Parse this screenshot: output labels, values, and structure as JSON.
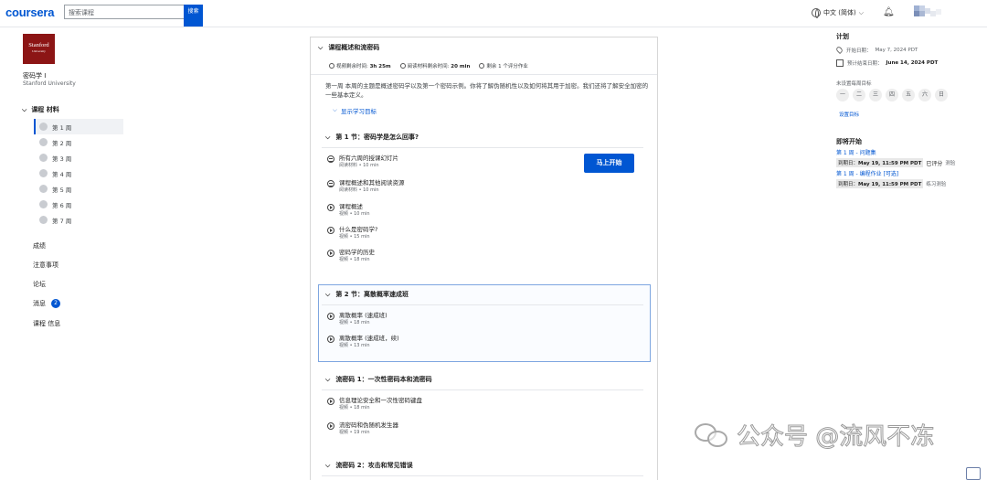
{
  "header": {
    "logo": "coursera",
    "search_placeholder": "搜索课程",
    "search_button": "搜索",
    "language": "中文 (简体)",
    "icons": [
      "globe-icon",
      "chevron-down-icon",
      "bell-icon",
      "avatar"
    ]
  },
  "sidebar": {
    "school_logo_text": "Stanford",
    "school_logo_sub": "University",
    "course_title": "密码学 I",
    "school": "Stanford University",
    "materials_label": "课程 材料",
    "weeks": [
      "第 1 周",
      "第 2 周",
      "第 3 周",
      "第 4 周",
      "第 5 周",
      "第 6 周",
      "第 7 周"
    ],
    "active_week_index": 0,
    "nav": [
      {
        "label": "成绩"
      },
      {
        "label": "注意事项"
      },
      {
        "label": "论坛"
      },
      {
        "label": "消息",
        "badge": "2"
      },
      {
        "label": "课程 信息"
      }
    ]
  },
  "main": {
    "module_title": "课程概述和流密码",
    "stats": [
      {
        "label": "视频剩余时间:",
        "value": "3h 25m"
      },
      {
        "label": "阅读材料剩余时间:",
        "value": "20 min"
      },
      {
        "label": "剩余 1 个评分作业",
        "value": ""
      }
    ],
    "description": "第一周 本周的主题是概述密码学以及第一个密码示例。你将了解伪随机性以及如何将其用于加密。我们还将了解安全加密的一些基本定义。",
    "goals_link": "显示学习目标",
    "start_button": "马上开始",
    "sections": [
      {
        "title": "第 1 节：密码学是怎么回事?",
        "items": [
          {
            "title": "所有六周的授课幻灯片",
            "meta": "阅读材料 • 10 min",
            "icon": "reading-icon"
          },
          {
            "title": "课程概述和其他阅读资源",
            "meta": "阅读材料 • 10 min",
            "icon": "reading-icon"
          },
          {
            "title": "课程概述",
            "meta": "视频 • 10 min",
            "icon": "play-icon"
          },
          {
            "title": "什么是密码学?",
            "meta": "视频 • 15 min",
            "icon": "play-icon"
          },
          {
            "title": "密码学的历史",
            "meta": "视频 • 18 min",
            "icon": "play-icon"
          }
        ]
      },
      {
        "title": "第 2 节：离散概率速成班",
        "items": [
          {
            "title": "离散概率 (速成班)",
            "meta": "视频 • 18 min",
            "icon": "play-icon"
          },
          {
            "title": "离散概率 (速成班，续)",
            "meta": "视频 • 13 min",
            "icon": "play-icon"
          }
        ]
      },
      {
        "title": "流密码 1：一次性密码本和流密码",
        "items": [
          {
            "title": "信息理论安全和一次性密码键盘",
            "meta": "视频 • 18 min",
            "icon": "play-icon"
          },
          {
            "title": "流密码和伪随机发生器",
            "meta": "视频 • 19 min",
            "icon": "play-icon"
          }
        ]
      },
      {
        "title": "流密码 2：攻击和常见错误",
        "items": []
      }
    ]
  },
  "right": {
    "plan_title": "计划",
    "start_date_label": "开始日期：",
    "start_date": "May 7, 2024 PDT",
    "end_date_label": "预计结束日期：",
    "end_date": "June 14, 2024 PDT",
    "days_label": "未设置每周目标",
    "days": [
      "一",
      "二",
      "三",
      "四",
      "五",
      "六",
      "日"
    ],
    "set_goal": "设置目标",
    "upcoming_title": "即将开始",
    "upcoming": [
      {
        "title": "第 1 周 - 问题集",
        "due_label": "到期日：",
        "due": "May 19, 11:59 PM PDT",
        "status": "已评分",
        "type": "测验"
      },
      {
        "title": "第 1 周 - 编程作业 [可选]",
        "due_label": "到期日：",
        "due": "May 19, 11:59 PM PDT",
        "status": "",
        "type": "练习测验"
      }
    ]
  },
  "watermark": {
    "text": "公众号 @流风不冻"
  },
  "colors": {
    "brand": "#0056d2",
    "stanford": "#8c1515"
  }
}
